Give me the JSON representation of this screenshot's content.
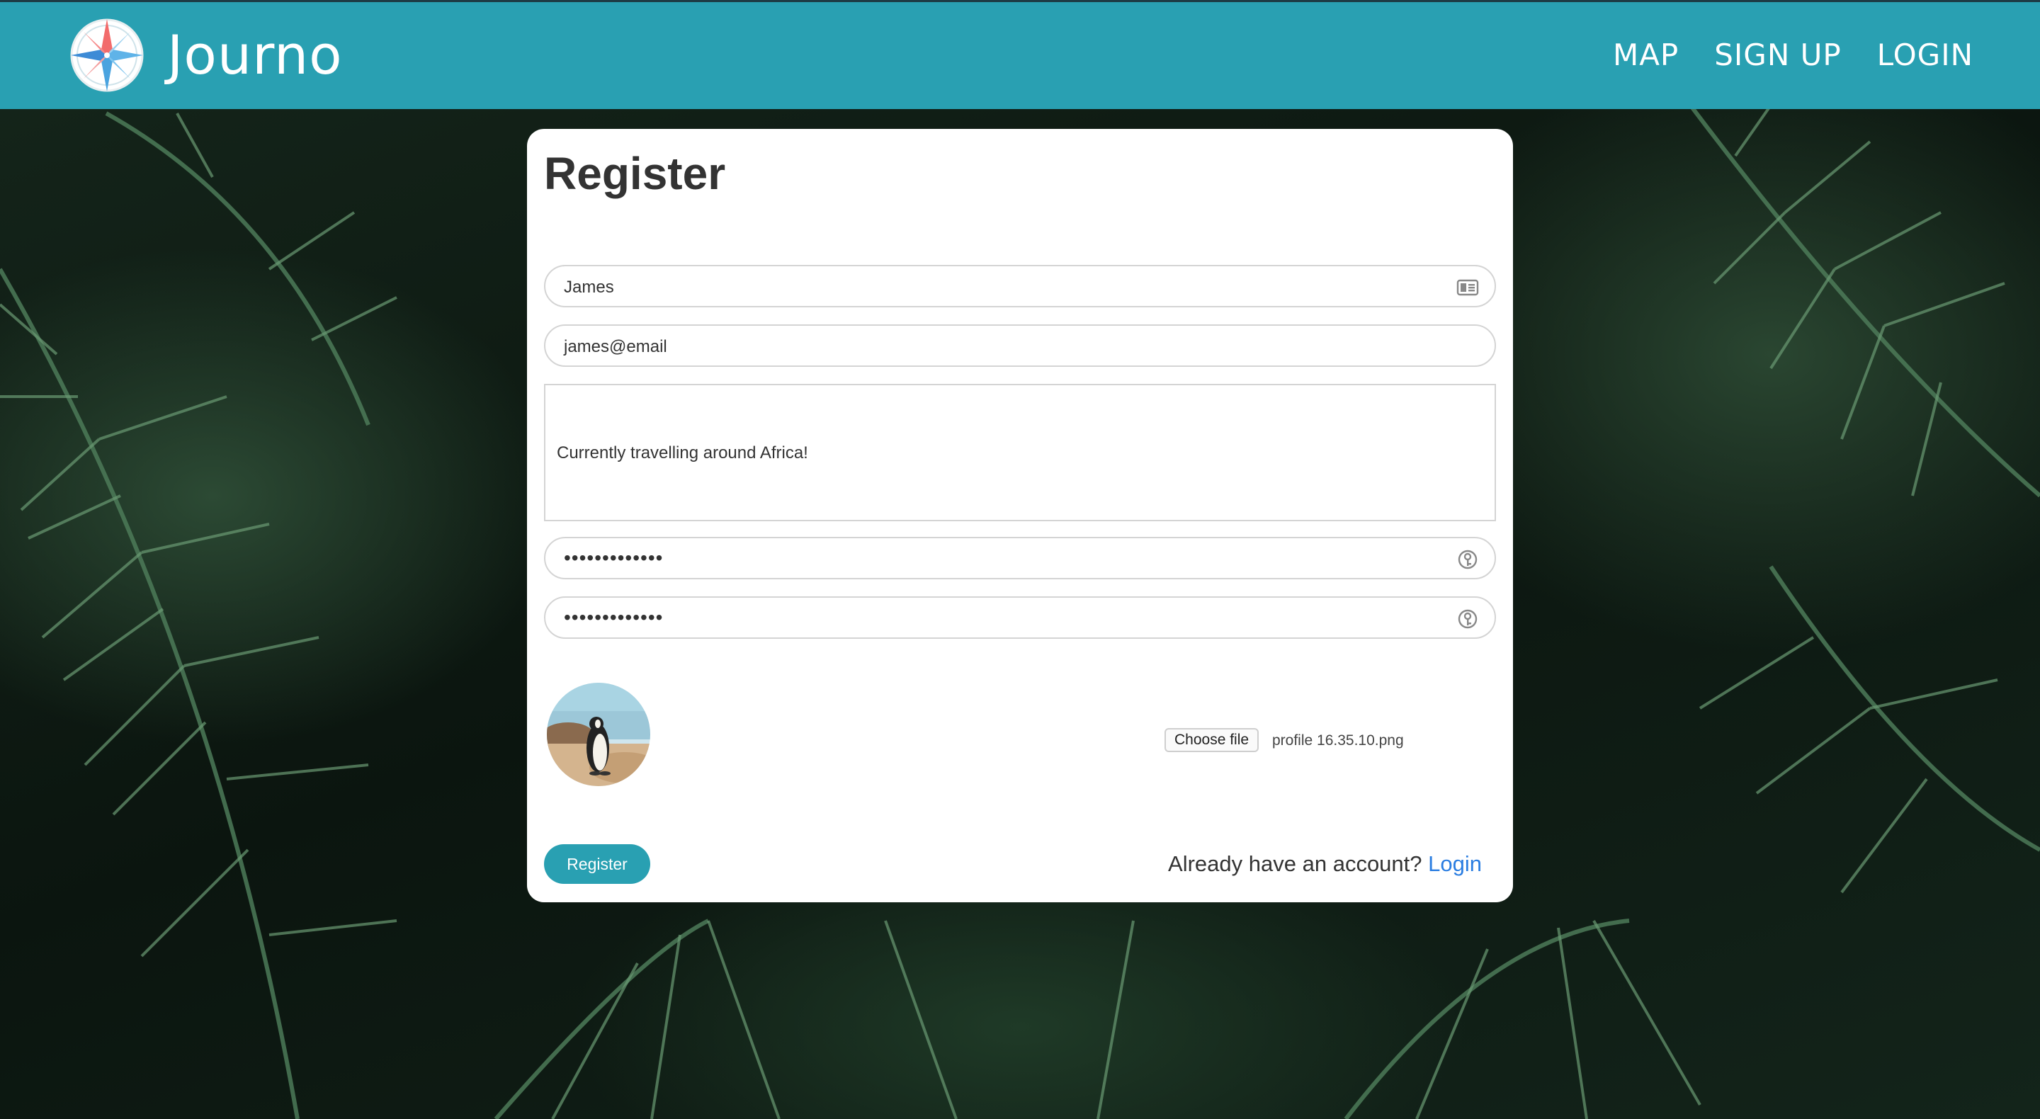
{
  "app": {
    "brand": "Journo",
    "colors": {
      "header": "#29a0b2",
      "link": "#2a7de1",
      "button": "#29a0b2"
    }
  },
  "nav": {
    "items": [
      {
        "label": "MAP"
      },
      {
        "label": "SIGN UP"
      },
      {
        "label": "LOGIN"
      }
    ]
  },
  "form": {
    "title": "Register",
    "name_value": "James",
    "name_icon": "contact-card-icon",
    "email_value": "james@email",
    "bio_value": "Currently travelling around Africa!",
    "password_value": "•••••••••••••",
    "password_icon": "password-key-icon",
    "confirm_password_value": "•••••••••••••",
    "confirm_password_icon": "password-key-icon",
    "avatar_icon": "profile-photo-penguin",
    "file_button_label": "Choose file",
    "file_name": "profile 16.35.10.png",
    "submit_label": "Register",
    "already_text": "Already have an account?",
    "login_link": "Login"
  }
}
